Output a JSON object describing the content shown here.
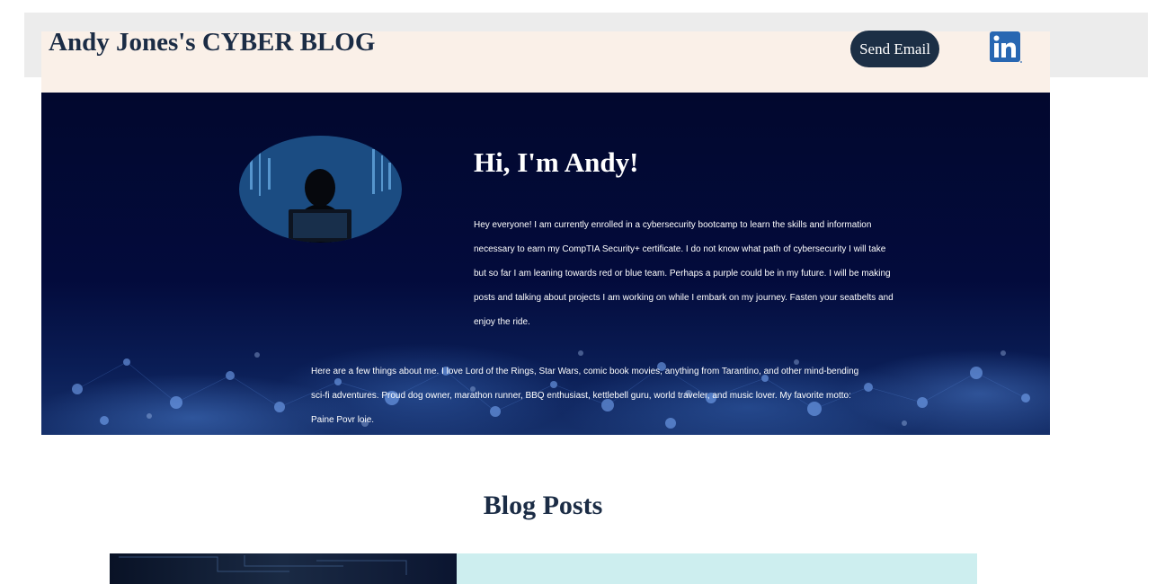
{
  "header": {
    "title": "Andy Jones's CYBER BLOG",
    "send_email_label": "Send Email",
    "linkedin_icon": "linkedin-icon"
  },
  "hero": {
    "heading": "Hi, I'm Andy!",
    "intro": "Hey everyone! I am currently enrolled in a cybersecurity bootcamp to learn the skills and information necessary to earn my CompTIA Security+ certificate. I do not know what path of cybersecurity I will take but so far I am leaning towards red or blue team. Perhaps a purple could be in my future. I will be making posts and talking about projects I am working on while I embark on my journey. Fasten your seatbelts and enjoy the ride.",
    "about": "Here are a few things about me. I love Lord of the Rings, Star Wars, comic book movies, anything from Tarantino, and other mind-bending sci-fi adventures. Proud dog owner, marathon runner, BBQ enthusiast, kettlebell guru, world traveler, and music lover. My favorite motto: Paine Povr loie."
  },
  "blog": {
    "heading": "Blog Posts"
  },
  "colors": {
    "navy": "#1c2f45",
    "hero_bg": "#030b3c",
    "cream": "#faf0e8",
    "post_panel": "#cdeeef",
    "linkedin_blue": "#2867b2"
  }
}
